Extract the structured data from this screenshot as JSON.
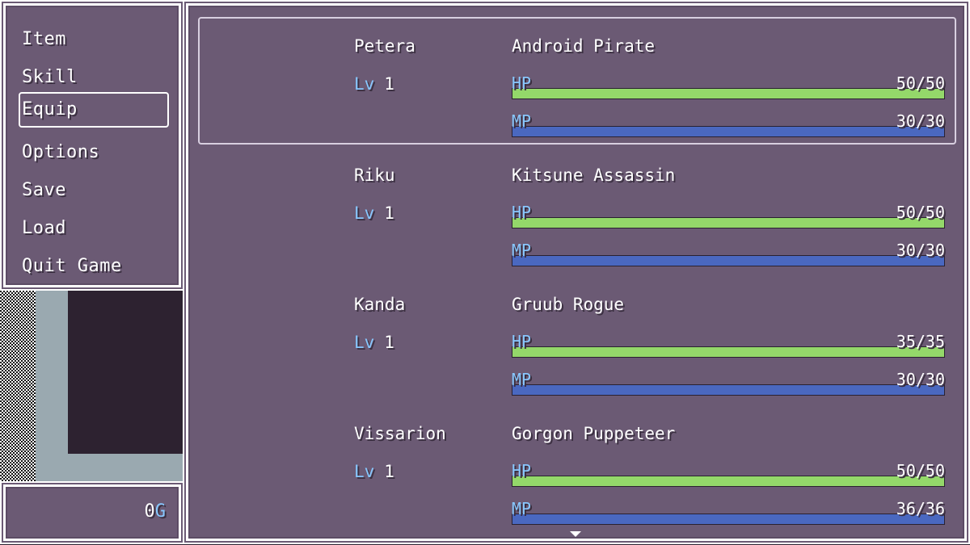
{
  "menu": {
    "commands": [
      "Item",
      "Skill",
      "Equip",
      "Options",
      "Save",
      "Load",
      "Quit Game"
    ],
    "selected_index": 2
  },
  "gold": {
    "amount": "0",
    "unit": "G"
  },
  "party": [
    {
      "name": "Petera",
      "class": "Android Pirate",
      "lv_label": "Lv",
      "level": "1",
      "hp_label": "HP",
      "hp": "50/50",
      "hp_ratio": 1.0,
      "mp_label": "MP",
      "mp": "30/30",
      "mp_ratio": 1.0
    },
    {
      "name": "Riku",
      "class": "Kitsune Assassin",
      "lv_label": "Lv",
      "level": "1",
      "hp_label": "HP",
      "hp": "50/50",
      "hp_ratio": 1.0,
      "mp_label": "MP",
      "mp": "30/30",
      "mp_ratio": 1.0
    },
    {
      "name": "Kanda",
      "class": "Gruub Rogue",
      "lv_label": "Lv",
      "level": "1",
      "hp_label": "HP",
      "hp": "35/35",
      "hp_ratio": 1.0,
      "mp_label": "MP",
      "mp": "30/30",
      "mp_ratio": 1.0
    },
    {
      "name": "Vissarion",
      "class": "Gorgon Puppeteer",
      "lv_label": "Lv",
      "level": "1",
      "hp_label": "HP",
      "hp": "50/50",
      "hp_ratio": 1.0,
      "mp_label": "MP",
      "mp": "36/36",
      "mp_ratio": 1.0
    }
  ],
  "selected_actor_index": 0,
  "colors": {
    "window_bg": "#6b5a74",
    "hp_gauge": "#94d86a",
    "mp_gauge": "#4a68c0",
    "system_text": "#88c8ff"
  },
  "icons": {
    "scroll_down": "down-arrow-icon"
  }
}
